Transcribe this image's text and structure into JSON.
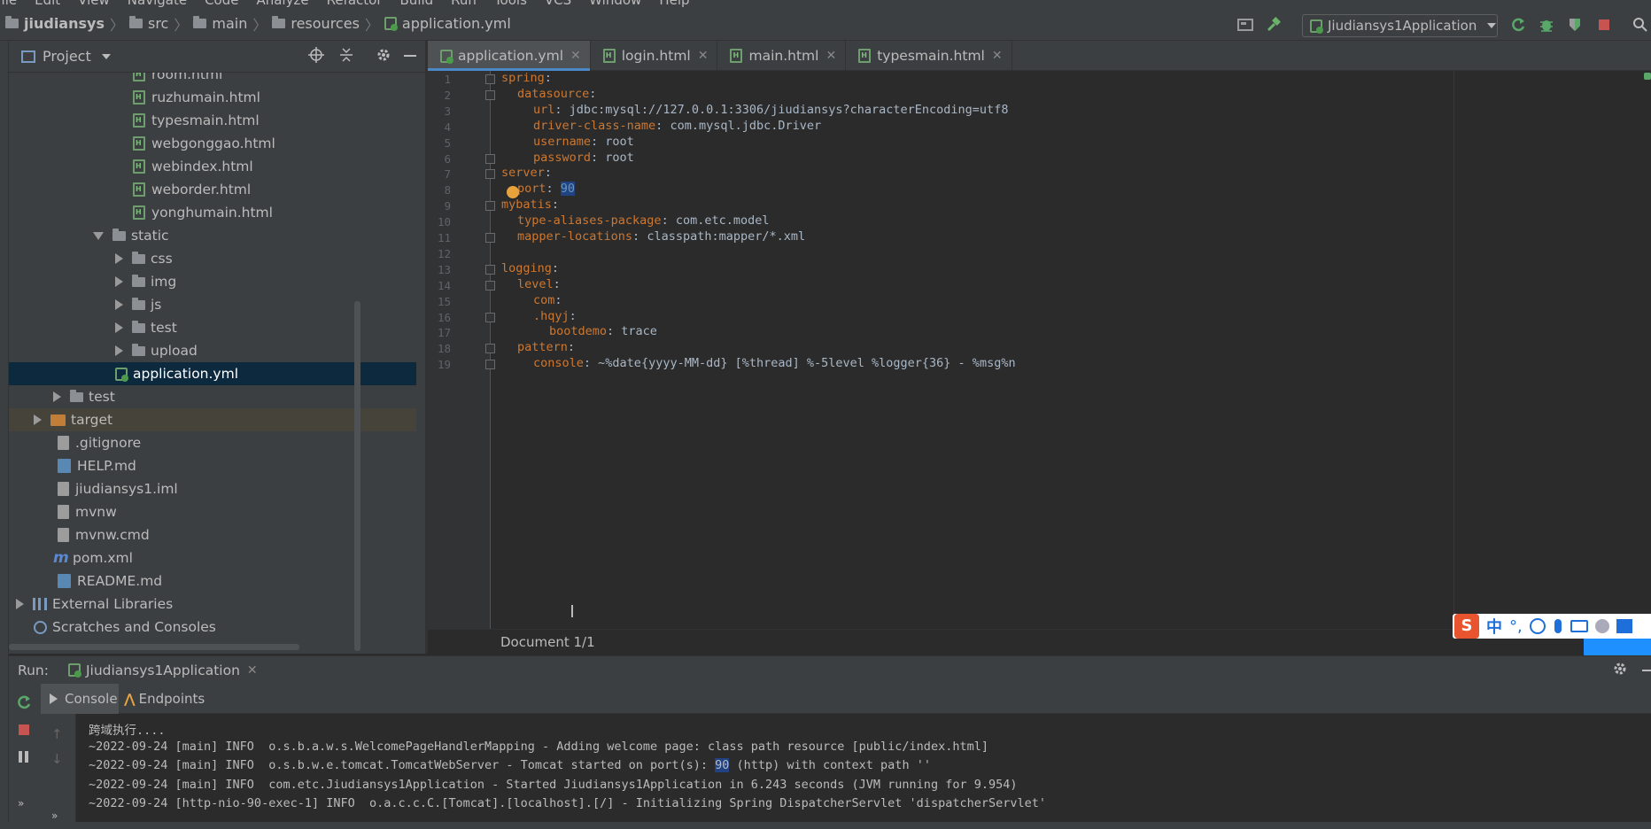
{
  "menu": [
    "File",
    "Edit",
    "View",
    "Navigate",
    "Code",
    "Analyze",
    "Refactor",
    "Build",
    "Run",
    "Tools",
    "VCS",
    "Window",
    "Help"
  ],
  "breadcrumb": [
    "jiudiansys",
    "src",
    "main",
    "resources",
    "application.yml"
  ],
  "toolbar": {
    "run_config": "Jiudiansys1Application"
  },
  "project": {
    "title": "Project",
    "tree": [
      {
        "label": "room.html",
        "type": "html"
      },
      {
        "label": "ruzhumain.html",
        "type": "html"
      },
      {
        "label": "typesmain.html",
        "type": "html"
      },
      {
        "label": "webgonggao.html",
        "type": "html"
      },
      {
        "label": "webindex.html",
        "type": "html"
      },
      {
        "label": "weborder.html",
        "type": "html"
      },
      {
        "label": "yonghumain.html",
        "type": "html"
      },
      {
        "label": "static",
        "type": "folder-open"
      },
      {
        "label": "css",
        "type": "folder"
      },
      {
        "label": "img",
        "type": "folder"
      },
      {
        "label": "js",
        "type": "folder"
      },
      {
        "label": "test",
        "type": "folder"
      },
      {
        "label": "upload",
        "type": "folder"
      },
      {
        "label": "application.yml",
        "type": "yml"
      },
      {
        "label": "test",
        "type": "folder"
      },
      {
        "label": "target",
        "type": "folder-orange"
      },
      {
        "label": ".gitignore",
        "type": "file"
      },
      {
        "label": "HELP.md",
        "type": "md"
      },
      {
        "label": "jiudiansys1.iml",
        "type": "file"
      },
      {
        "label": "mvnw",
        "type": "file"
      },
      {
        "label": "mvnw.cmd",
        "type": "file"
      },
      {
        "label": "pom.xml",
        "type": "maven"
      },
      {
        "label": "README.md",
        "type": "md"
      },
      {
        "label": "External Libraries",
        "type": "lib"
      },
      {
        "label": "Scratches and Consoles",
        "type": "scratch"
      }
    ]
  },
  "tabs": [
    {
      "label": "application.yml",
      "active": true
    },
    {
      "label": "login.html"
    },
    {
      "label": "main.html"
    },
    {
      "label": "typesmain.html"
    }
  ],
  "editor": {
    "lines": [
      {
        "n": "1",
        "key": "spring",
        "sep": ":",
        "val": "",
        "indent": 0
      },
      {
        "n": "2",
        "key": "datasource",
        "sep": ":",
        "val": "",
        "indent": 1
      },
      {
        "n": "3",
        "key": "url",
        "sep": ": ",
        "val": "jdbc:mysql://127.0.0.1:3306/jiudiansys?characterEncoding=utf8",
        "indent": 2
      },
      {
        "n": "4",
        "key": "driver-class-name",
        "sep": ": ",
        "val": "com.mysql.jdbc.Driver",
        "indent": 2
      },
      {
        "n": "5",
        "key": "username",
        "sep": ": ",
        "val": "root",
        "indent": 2
      },
      {
        "n": "6",
        "key": "password",
        "sep": ": ",
        "val": "root",
        "indent": 2
      },
      {
        "n": "7",
        "key": "server",
        "sep": ":",
        "val": "",
        "indent": 0
      },
      {
        "n": "8",
        "key": "port",
        "sep": ": ",
        "val": "90",
        "indent": 1
      },
      {
        "n": "9",
        "key": "mybatis",
        "sep": ":",
        "val": "",
        "indent": 0
      },
      {
        "n": "10",
        "key": "type-aliases-package",
        "sep": ": ",
        "val": "com.etc.model",
        "indent": 1
      },
      {
        "n": "11",
        "key": "mapper-locations",
        "sep": ": ",
        "val": "classpath:mapper/*.xml",
        "indent": 1
      },
      {
        "n": "12",
        "key": "",
        "sep": "",
        "val": "",
        "indent": 0
      },
      {
        "n": "13",
        "key": "logging",
        "sep": ":",
        "val": "",
        "indent": 0
      },
      {
        "n": "14",
        "key": "level",
        "sep": ":",
        "val": "",
        "indent": 1
      },
      {
        "n": "15",
        "key": "com",
        "sep": ":",
        "val": "",
        "indent": 2
      },
      {
        "n": "16",
        "key": ".hqyj",
        "sep": ":",
        "val": "",
        "indent": 2
      },
      {
        "n": "17",
        "key": "bootdemo",
        "sep": ": ",
        "val": "trace",
        "indent": 3
      },
      {
        "n": "18",
        "key": "pattern",
        "sep": ":",
        "val": "",
        "indent": 1
      },
      {
        "n": "19",
        "key": "console",
        "sep": ": ",
        "val": "~%date{yyyy-MM-dd} [%thread] %-5level %logger{36} - %msg%n",
        "indent": 2
      }
    ],
    "status": "Document 1/1"
  },
  "run": {
    "label": "Run:",
    "config": "Jiudiansys1Application",
    "tab_console": "Console",
    "tab_endpoints": "Endpoints",
    "lines": [
      "跨域执行....",
      "~2022-09-24 [main] INFO  o.s.b.a.w.s.WelcomePageHandlerMapping - Adding welcome page: class path resource [public/index.html]",
      "~2022-09-24 [main] INFO  o.s.b.w.e.tomcat.TomcatWebServer - Tomcat started on port(s): |90| (http) with context path ''",
      "~2022-09-24 [main] INFO  com.etc.Jiudiansys1Application - Started Jiudiansys1Application in 6.243 seconds (JVM running for 9.954)",
      "~2022-09-24 [http-nio-90-exec-1] INFO  o.a.c.c.C.[Tomcat].[localhost].[/] - Initializing Spring DispatcherServlet 'dispatcherServlet'"
    ]
  },
  "ime": {
    "label": "中"
  },
  "colors": {
    "accent": "#4a88c7",
    "selection": "#0d293e",
    "yaml_key": "#cc7832",
    "number": "#6897bb"
  }
}
